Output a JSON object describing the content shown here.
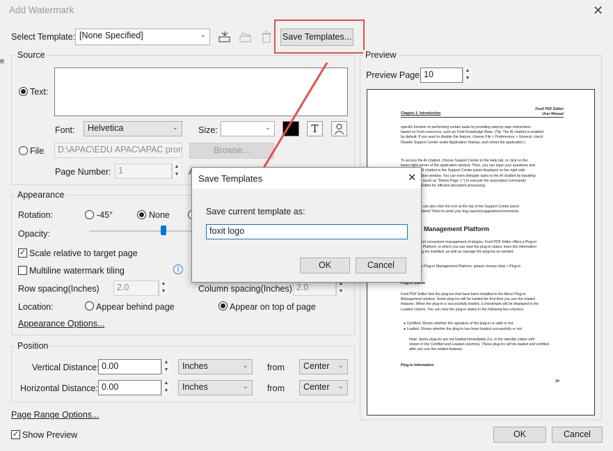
{
  "window": {
    "title": "Add Watermark"
  },
  "template": {
    "label": "Select Template:",
    "value": "[None Specified]",
    "save_button": "Save Templates..."
  },
  "source": {
    "group": "Source",
    "text_radio": "Text:",
    "font_label": "Font:",
    "font_value": "Helvetica",
    "size_label": "Size:",
    "size_value": "",
    "file_radio": "File",
    "file_path": "D:\\APAC\\EDU APAC\\APAC promo",
    "browse": "Browse...",
    "page_number_label": "Page Number:",
    "page_number_value": "1",
    "a_label": "A"
  },
  "appearance": {
    "group": "Appearance",
    "rotation_label": "Rotation:",
    "rot_neg45": "-45°",
    "rot_none": "None",
    "opacity_label": "Opacity:",
    "opacity_fraction": 0.72,
    "scale_label": "Scale relative to target page",
    "tiling_label": "Multiline watermark tiling",
    "row_spacing_label": "Row spacing(Inches)",
    "row_spacing_value": "2.0",
    "column_spacing_label": "Column spacing(Inches)",
    "column_spacing_value": "2.0",
    "location_label": "Location:",
    "behind": "Appear behind page",
    "ontop": "Appear on top of page",
    "options_link": "Appearance Options..."
  },
  "position": {
    "group": "Position",
    "vertical_label": "Vertical Distance:",
    "vertical_value": "0.00",
    "vertical_unit": "Inches",
    "horizontal_label": "Horizontal Distance:",
    "horizontal_value": "0.00",
    "horizontal_unit": "Inches",
    "from": "from",
    "vertical_from": "Center",
    "horizontal_from": "Center"
  },
  "footer": {
    "page_range": "Page Range Options...",
    "show_preview": "Show Preview",
    "ok": "OK",
    "cancel": "Cancel"
  },
  "preview": {
    "group": "Preview",
    "page_label": "Preview Page:",
    "page_value": "10"
  },
  "doc": {
    "header1": "Foxit PDF Editor",
    "header2": "User Manual",
    "chapter": "Chapter 1: Introduction",
    "p1": [
      "specific function or performing certain tasks by providing step-by-step instructions",
      "based on Foxit resources, such as Foxit Knowledge Base. (Tip: The AI chatbot is enabled",
      "by default. If you want to disable the feature, choose File > Preferences > General, check",
      "Disable Support Center under Application Startup, and restart the application.)"
    ],
    "p2": [
      "To access the AI chatbot, choose Support Center in the Help tab, or click        on the",
      "lower-right corner of the application window. Then, you can input your questions and",
      "ask with the AI chatbot in the Support Center panel displayed on the right side",
      "of the application window. You can even delegate tasks to the AI chatbot by inputting",
      "requirements (such as \"Delete Page 1.\") to execute the associated commands",
      "in Foxit PDF Editor for efficient document processing."
    ],
    "p3": [
      "Besides, you can also click the      icon at the top of the Support Center panel",
      "to create a Submit Ticket to send your bug reports/suggestions/comments."
    ],
    "h2": "Plug-in Management Platform",
    "p4": [
      "It is a quick and convenient management of plugins. Foxit PDF Editor offers a Plug-in",
      "Management Platform, in which you can view the plug-in status, learn the information",
      "about the plug-ins installed, as well as manage the plug-ins as needed."
    ],
    "p5": [
      "To access the Plug-in Management Platform, please choose Help > Plug-in",
      "Management."
    ],
    "h3": "Plug-in Status",
    "p6": [
      "Foxit PDF Editor lists the plug-ins that have been installed in the About Plug-in",
      "Management window. Some plug-ins will be loaded the first time you use the related",
      "features. When the plug-in is successfully loaded, a checkmark will be displayed in the",
      "Loaded column. You can view the plug-in status in the following two columns:"
    ],
    "b1": "Certified: Shows whether the signature of the plug-in is valid or not.",
    "b2": "Loaded: Shows whether the plug-in has been loaded successfully or not.",
    "note": [
      "Note: Some plug-ins are not loaded immediately (i.e. in the standby status with",
      "shown in the Certified and Loaded columns). These plug-ins will be loaded and certified",
      "after you use the related features."
    ],
    "h4": "Plug-in Information",
    "pagenum": "10"
  },
  "dialog": {
    "title": "Save Templates",
    "prompt": "Save current template as:",
    "value": "foxit logo",
    "ok": "OK",
    "cancel": "Cancel"
  },
  "colors": {
    "highlight": "#e0524c",
    "arrow": "#e0524c"
  }
}
